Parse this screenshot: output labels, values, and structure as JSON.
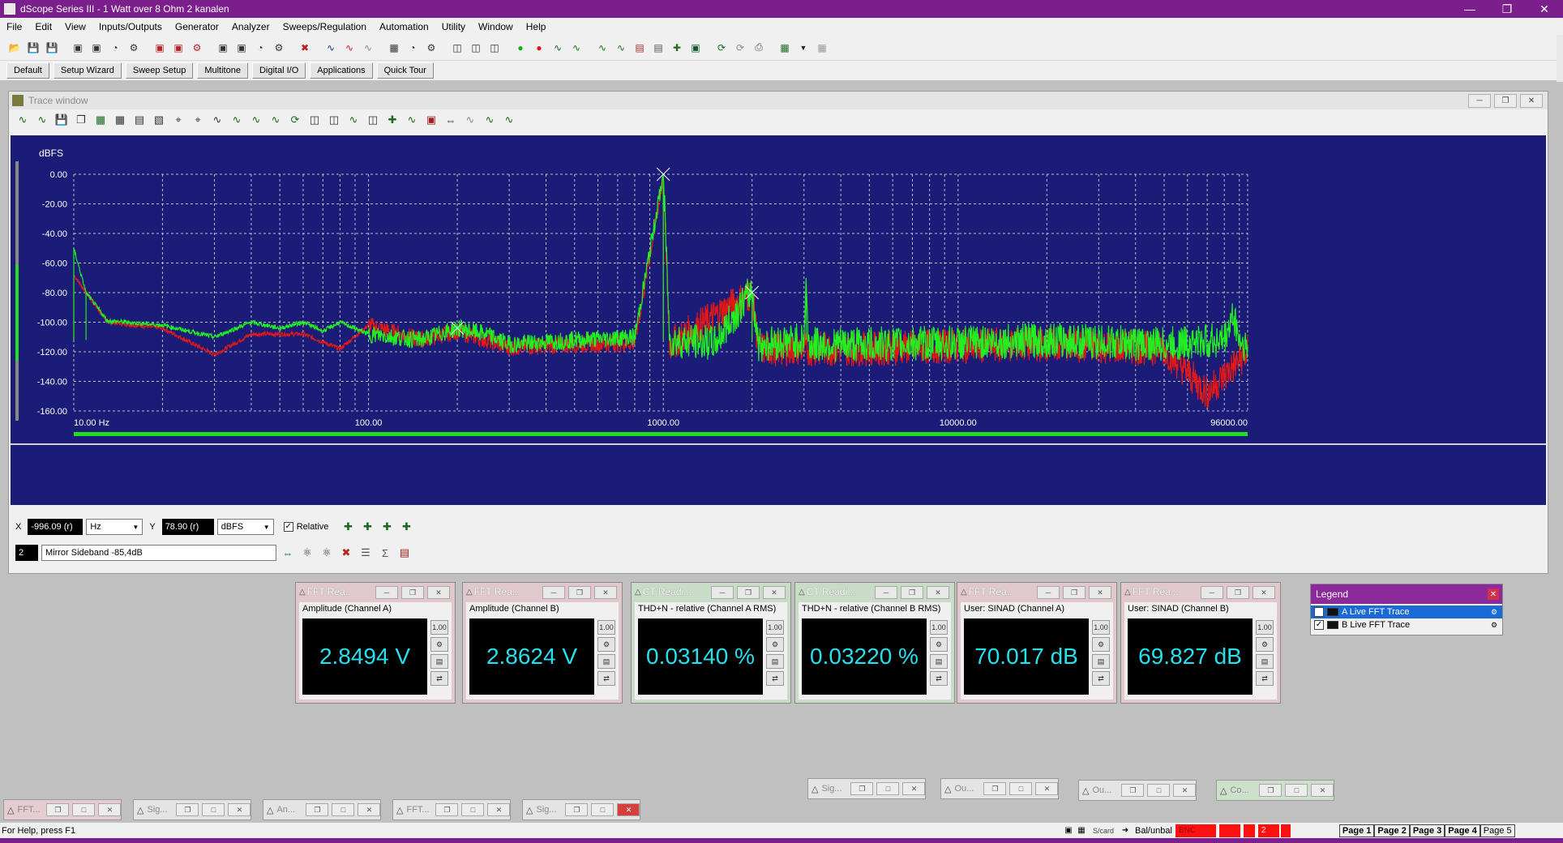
{
  "window": {
    "title": "dScope Series III - 1 Watt over 8 Ohm 2 kanalen"
  },
  "menu": [
    "File",
    "Edit",
    "View",
    "Inputs/Outputs",
    "Generator",
    "Analyzer",
    "Sweeps/Regulation",
    "Automation",
    "Utility",
    "Window",
    "Help"
  ],
  "quick_buttons": [
    "Default",
    "Setup Wizard",
    "Sweep Setup",
    "Multitone",
    "Digital I/O",
    "Applications",
    "Quick Tour"
  ],
  "trace_window": {
    "title": "Trace window",
    "cursor_x_label": "X",
    "cursor_x_value": "-996.09 (r)",
    "cursor_x_unit": "Hz",
    "cursor_y_label": "Y",
    "cursor_y_value": "78.90 (r)",
    "cursor_y_unit": "dBFS",
    "relative_label": "Relative",
    "relative_checked": true,
    "marker_index": "2",
    "marker_text": "Mirror Sideband -85,4dB"
  },
  "chart_data": {
    "type": "line",
    "ylabel": "dBFS",
    "xscale": "log",
    "xlim": [
      10,
      96000
    ],
    "ylim": [
      -160,
      0
    ],
    "x_tick_labels": [
      "10.00 Hz",
      "100.00",
      "1000.00",
      "10000.00",
      "96000.00"
    ],
    "y_tick_labels": [
      "0.00",
      "-20.00",
      "-40.00",
      "-60.00",
      "-80.00",
      "-100.00",
      "-120.00",
      "-140.00",
      "-160.00"
    ],
    "grid": true,
    "series": [
      {
        "name": "A Live FFT Trace",
        "color": "#22ee22",
        "points": [
          [
            10,
            -50
          ],
          [
            11,
            -80
          ],
          [
            13,
            -99
          ],
          [
            20,
            -102
          ],
          [
            30,
            -110
          ],
          [
            40,
            -100
          ],
          [
            50,
            -104
          ],
          [
            60,
            -100
          ],
          [
            70,
            -106
          ],
          [
            80,
            -100
          ],
          [
            100,
            -108
          ],
          [
            150,
            -112
          ],
          [
            200,
            -104
          ],
          [
            250,
            -108
          ],
          [
            300,
            -115
          ],
          [
            500,
            -112
          ],
          [
            800,
            -110
          ],
          [
            1000,
            0
          ],
          [
            1050,
            -112
          ],
          [
            1500,
            -114
          ],
          [
            2000,
            -78
          ],
          [
            2100,
            -115
          ],
          [
            3000,
            -112
          ],
          [
            3050,
            -70
          ],
          [
            3100,
            -115
          ],
          [
            5000,
            -115
          ],
          [
            10000,
            -114
          ],
          [
            20000,
            -112
          ],
          [
            50000,
            -115
          ],
          [
            80000,
            -112
          ],
          [
            86000,
            -95
          ],
          [
            90000,
            -112
          ],
          [
            96000,
            -118
          ]
        ]
      },
      {
        "name": "B Live FFT Trace",
        "color": "#e01818",
        "points": [
          [
            10,
            -68
          ],
          [
            13,
            -100
          ],
          [
            20,
            -104
          ],
          [
            30,
            -122
          ],
          [
            40,
            -108
          ],
          [
            60,
            -108
          ],
          [
            80,
            -118
          ],
          [
            100,
            -102
          ],
          [
            150,
            -112
          ],
          [
            200,
            -106
          ],
          [
            300,
            -117
          ],
          [
            500,
            -115
          ],
          [
            800,
            -114
          ],
          [
            1000,
            -2
          ],
          [
            1050,
            -115
          ],
          [
            2000,
            -80
          ],
          [
            2100,
            -118
          ],
          [
            5000,
            -118
          ],
          [
            10000,
            -116
          ],
          [
            20000,
            -115
          ],
          [
            50000,
            -118
          ],
          [
            70000,
            -148
          ],
          [
            96000,
            -120
          ]
        ]
      }
    ]
  },
  "readers": [
    {
      "title": "FFT Rea...",
      "label": "Amplitude (Channel A)",
      "value": "2.8494 V",
      "theme": "pink"
    },
    {
      "title": "FFT Rea...",
      "label": "Amplitude (Channel B)",
      "value": "2.8624 V",
      "theme": "pink"
    },
    {
      "title": "CT Readi...",
      "label": "THD+N - relative (Channel A RMS)",
      "value": "0.03140 %",
      "theme": "green"
    },
    {
      "title": "CT Readi...",
      "label": "THD+N - relative (Channel B RMS)",
      "value": "0.03220 %",
      "theme": "green"
    },
    {
      "title": "FFT Rea...",
      "label": "User: SINAD (Channel A)",
      "value": "70.017 dB",
      "theme": "pink"
    },
    {
      "title": "FFT Rea...",
      "label": "User: SINAD (Channel B)",
      "value": "69.827 dB",
      "theme": "pink"
    }
  ],
  "legend": {
    "title": "Legend",
    "items": [
      {
        "label": "A  Live FFT Trace",
        "checked": true,
        "selected": true
      },
      {
        "label": "B  Live FFT Trace",
        "checked": true,
        "selected": false
      }
    ]
  },
  "minimized": [
    {
      "label": "FFT...",
      "theme": "pink"
    },
    {
      "label": "Sig...",
      "theme": "plain"
    },
    {
      "label": "An...",
      "theme": "plain"
    },
    {
      "label": "FFT...",
      "theme": "plain"
    },
    {
      "label": "Sig...",
      "theme": "plain"
    },
    {
      "label": "Sig...",
      "theme": "plain"
    },
    {
      "label": "Ou...",
      "theme": "plain"
    },
    {
      "label": "Ou...",
      "theme": "plain"
    },
    {
      "label": "Co...",
      "theme": "green"
    }
  ],
  "status": {
    "help": "For Help, press F1",
    "s_card": "S/card",
    "balance": "Bal/unbal",
    "connector": "BNC",
    "count": "2",
    "pages": [
      "Page 1",
      "Page 2",
      "Page 3",
      "Page 4",
      "Page 5"
    ]
  }
}
